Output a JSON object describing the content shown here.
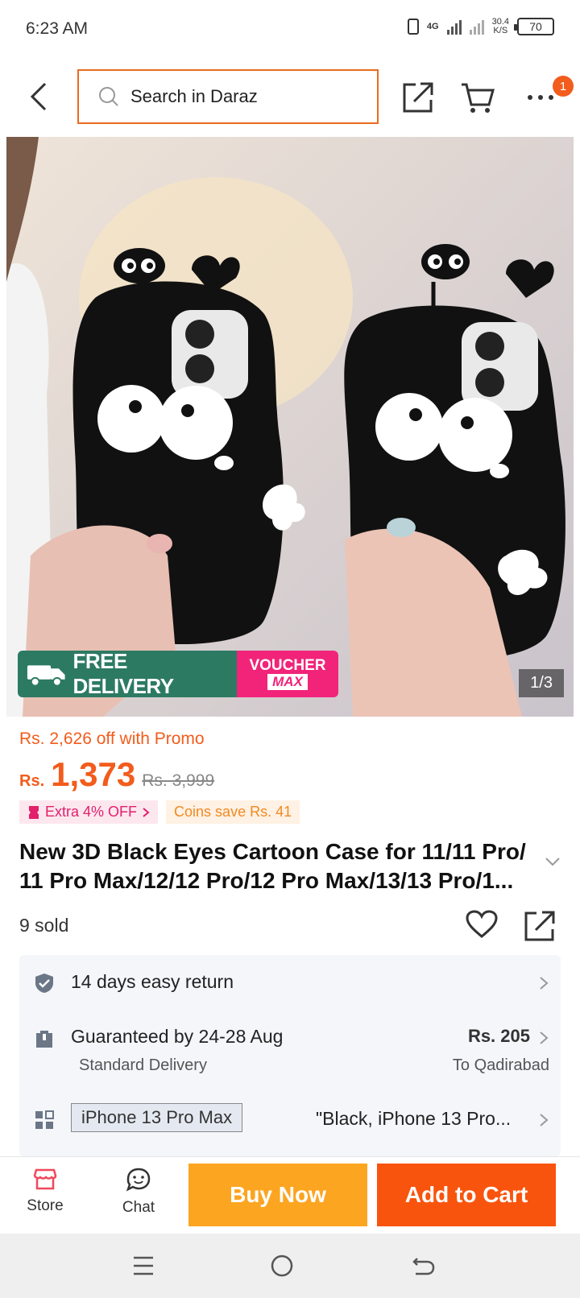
{
  "status_bar": {
    "time": "6:23 AM",
    "network": "4G",
    "speed_value": "30.4",
    "speed_unit": "K/S",
    "battery": "70"
  },
  "header": {
    "search_placeholder": "Search in Daraz",
    "more_badge_count": "1"
  },
  "hero": {
    "free_tag": "FREE",
    "free_delivery_label": "FREE DELIVERY",
    "voucher_line1": "VOUCHER",
    "voucher_line2": "MAX",
    "image_counter": "1/3"
  },
  "price": {
    "promo_text": "Rs. 2,626 off with Promo",
    "currency": "Rs.",
    "current": "1,373",
    "original": "Rs. 3,999",
    "extra_off": "Extra 4% OFF",
    "coins_save": "Coins save Rs. 41"
  },
  "product": {
    "title": "New 3D Black Eyes Cartoon Case for 11/11 Pro/ 11 Pro Max/12/12 Pro/12 Pro Max/13/13 Pro/1...",
    "sold": "9 sold"
  },
  "info": {
    "return_text": "14 days easy return",
    "delivery_text": "Guaranteed by 24-28 Aug",
    "delivery_type": "Standard Delivery",
    "delivery_price": "Rs. 205",
    "delivery_location": "To Qadirabad",
    "variant_selected": "iPhone 13 Pro Max",
    "variant_summary": "\"Black, iPhone 13 Pro..."
  },
  "bottom_bar": {
    "store_label": "Store",
    "chat_label": "Chat",
    "buy_now_label": "Buy Now",
    "add_to_cart_label": "Add to Cart"
  },
  "colors": {
    "accent_orange": "#f9540d",
    "buy_now_yellow": "#fca521",
    "promo_green": "#2d7a63",
    "voucher_pink": "#f1247a"
  }
}
